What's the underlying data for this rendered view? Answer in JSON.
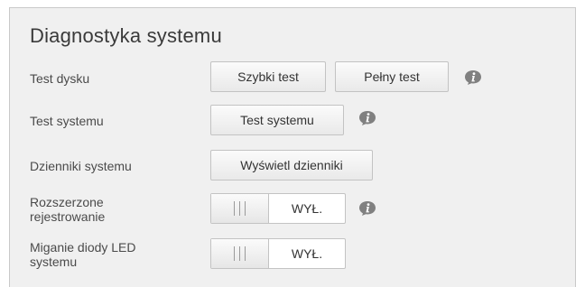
{
  "section": {
    "title": "Diagnostyka systemu"
  },
  "rows": {
    "disk_test": {
      "label": "Test dysku",
      "quick_test_button": "Szybki test",
      "full_test_button": "Pełny test",
      "info_icon": "info-icon"
    },
    "system_test": {
      "label": "Test systemu",
      "button": "Test systemu",
      "info_icon": "info-icon"
    },
    "system_logs": {
      "label": "Dzienniki systemu",
      "button": "Wyświetl dzienniki"
    },
    "extended_logging": {
      "label_line1": "Rozszerzone",
      "label_line2": "rejestrowanie",
      "toggle_state": "WYŁ.",
      "info_icon": "info-icon"
    },
    "led_blink": {
      "label_line1": "Miganie diody LED",
      "label_line2": "systemu",
      "toggle_state": "WYŁ."
    }
  },
  "colors": {
    "panel_background": "#f0f0f0",
    "info_icon": "#808080",
    "text": "#333333"
  }
}
